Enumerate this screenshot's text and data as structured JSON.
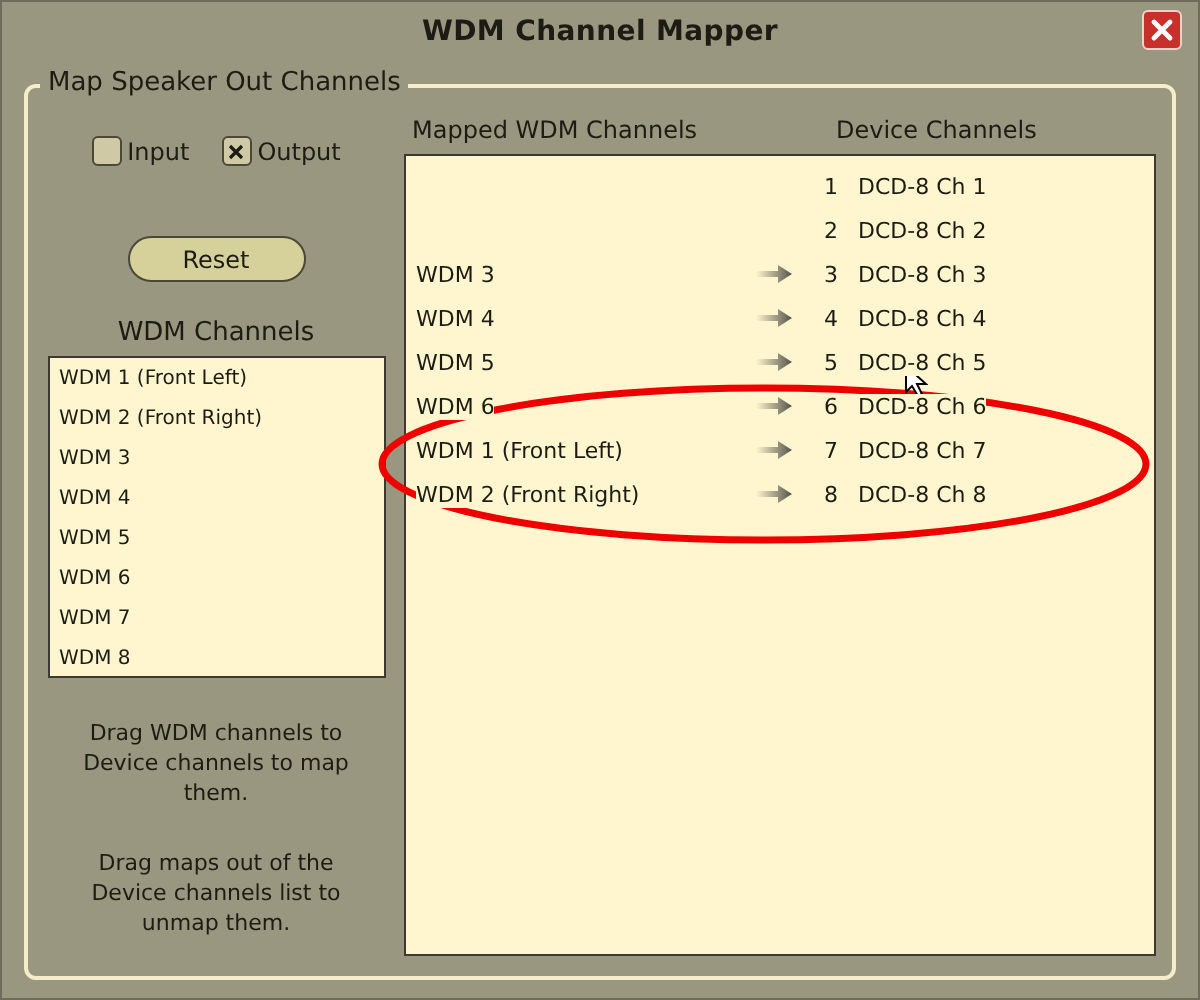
{
  "window": {
    "title": "WDM Channel Mapper"
  },
  "group": {
    "legend": "Map Speaker Out Channels"
  },
  "direction_options": [
    {
      "label": "Input",
      "checked": false
    },
    {
      "label": "Output",
      "checked": true
    }
  ],
  "reset_button": "Reset",
  "wdm_channels": {
    "title": "WDM Channels",
    "items": [
      "WDM 1 (Front Left)",
      "WDM 2 (Front Right)",
      "WDM 3",
      "WDM 4",
      "WDM 5",
      "WDM 6",
      "WDM 7",
      "WDM 8"
    ]
  },
  "help_text": [
    "Drag WDM channels to Device channels to map them.",
    "Drag maps out of the Device channels list to unmap them."
  ],
  "mapping": {
    "mapped_header": "Mapped WDM Channels",
    "device_header": "Device Channels",
    "rows": [
      {
        "number": "1",
        "device": "DCD-8 Ch 1",
        "mapped": false
      },
      {
        "number": "2",
        "device": "DCD-8 Ch 2",
        "mapped": false
      },
      {
        "wdm": "WDM 3",
        "number": "3",
        "device": "DCD-8 Ch 3",
        "mapped": true
      },
      {
        "wdm": "WDM 4",
        "number": "4",
        "device": "DCD-8 Ch 4",
        "mapped": true
      },
      {
        "wdm": "WDM 5",
        "number": "5",
        "device": "DCD-8 Ch 5",
        "mapped": true
      },
      {
        "wdm": "WDM 6",
        "number": "6",
        "device": "DCD-8 Ch 6",
        "mapped": true
      },
      {
        "wdm": "WDM 1 (Front Left)",
        "number": "7",
        "device": "DCD-8 Ch 7",
        "mapped": true
      },
      {
        "wdm": "WDM 2 (Front Right)",
        "number": "8",
        "device": "DCD-8 Ch 8",
        "mapped": true
      }
    ]
  }
}
